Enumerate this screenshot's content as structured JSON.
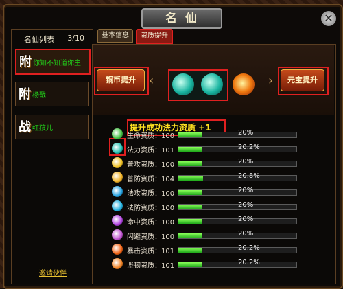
{
  "window": {
    "title": "名仙"
  },
  "left_panel": {
    "header": "名仙列表",
    "count": "3/10",
    "items": [
      {
        "glyph": "附",
        "name": "你知不知道你主"
      },
      {
        "glyph": "附",
        "name": "杨戬"
      },
      {
        "glyph": "战",
        "name": "红孩儿"
      }
    ],
    "invite": "邀请伙伴"
  },
  "tabs": [
    {
      "label": "基本信息"
    },
    {
      "label": "资质提升"
    }
  ],
  "buttons": {
    "copper": "铜币提升",
    "yuanbao": "元宝提升"
  },
  "toast": "提升成功法力资质 +1",
  "stats": [
    {
      "label": "生命资质：100",
      "pct": "20%",
      "fill": 0.2,
      "color": "#40c040"
    },
    {
      "label": "法力资质：101",
      "pct": "20.2%",
      "fill": 0.202,
      "color": "#20c0b0"
    },
    {
      "label": "普攻资质：100",
      "pct": "20%",
      "fill": 0.2,
      "color": "#f0c020"
    },
    {
      "label": "普防资质：104",
      "pct": "20.8%",
      "fill": 0.208,
      "color": "#f0b020"
    },
    {
      "label": "法攻资质：100",
      "pct": "20%",
      "fill": 0.2,
      "color": "#20a0e0"
    },
    {
      "label": "法防资质：100",
      "pct": "20%",
      "fill": 0.2,
      "color": "#20b0e0"
    },
    {
      "label": "命中资质：100",
      "pct": "20%",
      "fill": 0.2,
      "color": "#b040e0"
    },
    {
      "label": "闪避资质：100",
      "pct": "20%",
      "fill": 0.2,
      "color": "#c050d0"
    },
    {
      "label": "暴击资质：101",
      "pct": "20.2%",
      "fill": 0.202,
      "color": "#f06010"
    },
    {
      "label": "坚韧资质：101",
      "pct": "20.2%",
      "fill": 0.202,
      "color": "#f08020"
    }
  ]
}
